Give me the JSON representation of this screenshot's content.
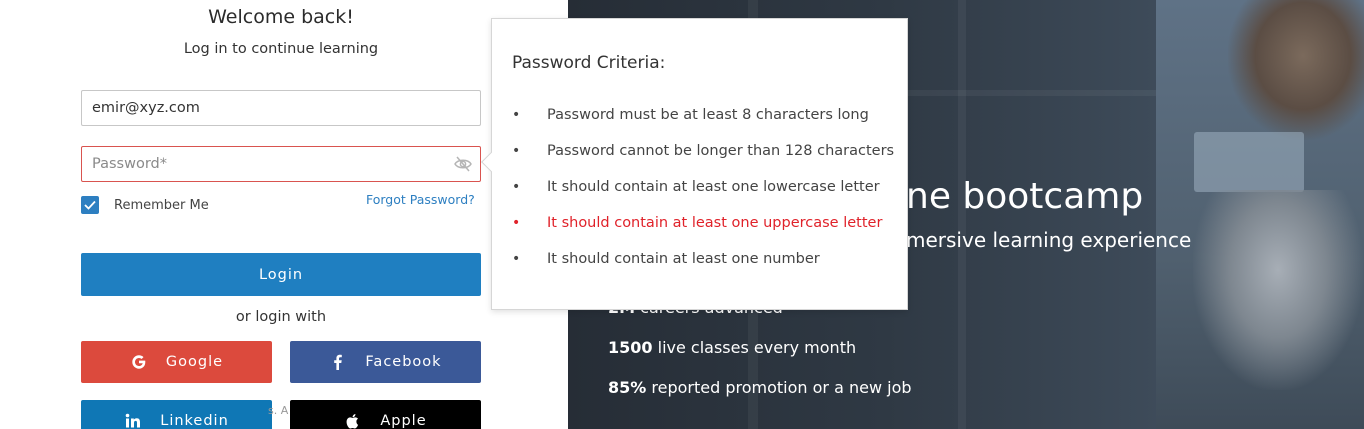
{
  "login": {
    "title": "Welcome back!",
    "subtitle": "Log in to continue learning",
    "email_value": "emir@xyz.com",
    "password_placeholder": "Password*",
    "remember_label": "Remember Me",
    "forgot_label": "Forgot Password?",
    "login_label": "Login",
    "or_label": "or login with",
    "social": {
      "google": "Google",
      "facebook": "Facebook",
      "linkedin": "Linkedin",
      "apple": "Apple"
    },
    "behind_text": "s. A"
  },
  "hero": {
    "heading": "ne bootcamp",
    "subheading": "mersive learning experience",
    "stats": [
      {
        "value": "2M",
        "text": " careers advanced"
      },
      {
        "value": "1500",
        "text": " live classes every month"
      },
      {
        "value": "85%",
        "text": " reported promotion or a new job"
      }
    ]
  },
  "password_criteria": {
    "title": "Password Criteria:",
    "items": [
      {
        "text": "Password must be at least 8 characters long",
        "status": "ok"
      },
      {
        "text": "Password cannot be longer than 128 characters",
        "status": "ok"
      },
      {
        "text": "It should contain at least one lowercase letter",
        "status": "ok"
      },
      {
        "text": "It should contain at least one uppercase letter",
        "status": "fail"
      },
      {
        "text": "It should contain at least one number",
        "status": "ok"
      }
    ]
  },
  "colors": {
    "primary": "#1f7fc1",
    "error": "#e0222a",
    "google": "#dc4a3d",
    "facebook": "#3b5998",
    "linkedin": "#0f77b5",
    "apple": "#000000"
  },
  "icons": {
    "password_toggle": "eye-off-icon",
    "checkbox": "checkmark-icon",
    "google": "google-icon",
    "facebook": "facebook-icon",
    "linkedin": "linkedin-icon",
    "apple": "apple-icon"
  }
}
